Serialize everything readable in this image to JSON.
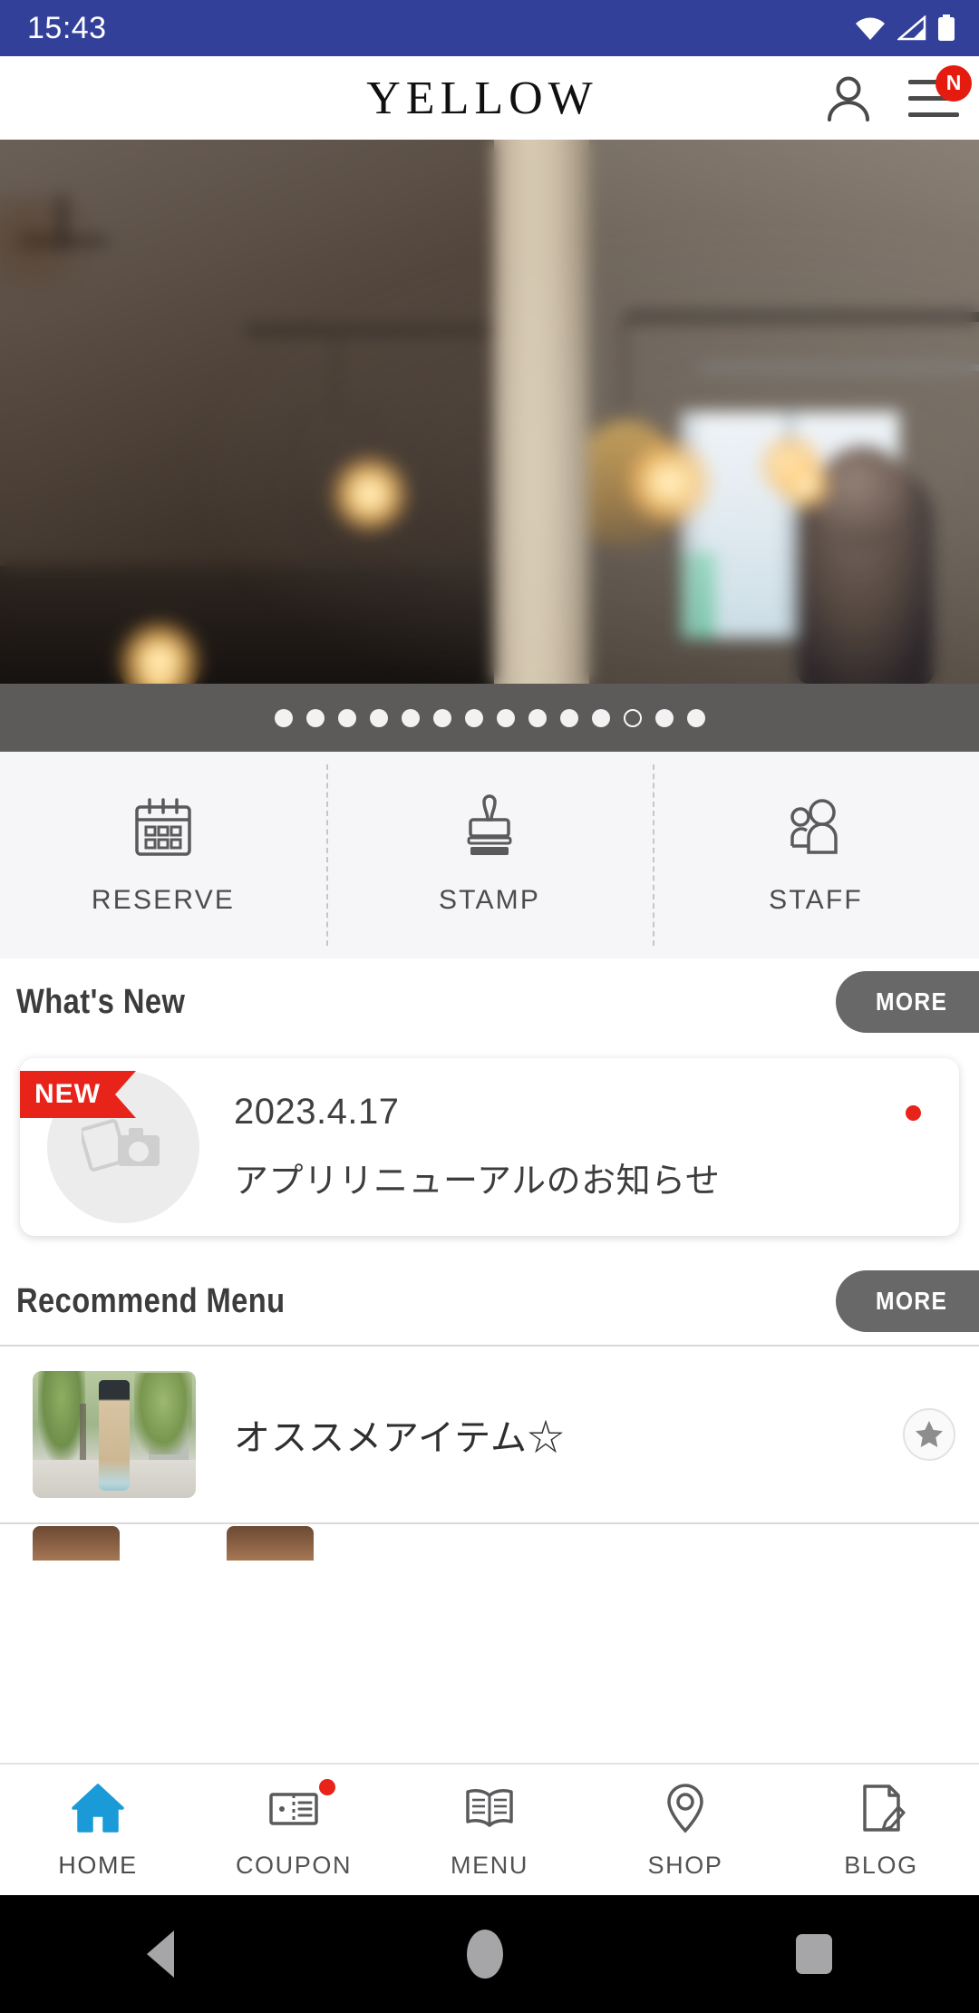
{
  "status_bar": {
    "time": "15:43",
    "icons": [
      "wifi-icon",
      "cellular-signal-icon",
      "battery-icon"
    ],
    "background_color": "#32409a"
  },
  "header": {
    "brand": "YELLOW",
    "account_icon": "person-icon",
    "menu_icon": "hamburger-menu-icon",
    "menu_badge": "N",
    "badge_color": "#e51b0f"
  },
  "hero": {
    "description": "blurred salon interior with pendant lights and window",
    "carousel": {
      "total_dots": 14,
      "active_index": 11
    }
  },
  "quick_actions": [
    {
      "label": "RESERVE",
      "icon": "calendar-icon"
    },
    {
      "label": "STAMP",
      "icon": "stamp-icon"
    },
    {
      "label": "STAFF",
      "icon": "people-icon"
    }
  ],
  "whats_new": {
    "title": "What's New",
    "more_label": "MORE",
    "items": [
      {
        "badge": "NEW",
        "date": "2023.4.17",
        "title": "アプリリニューアルのお知らせ",
        "thumbnail_icon": "photo-camera-placeholder-icon",
        "unread": true
      }
    ]
  },
  "recommend_menu": {
    "title": "Recommend Menu",
    "more_label": "MORE",
    "items": [
      {
        "title": "オススメアイテム☆",
        "favorite_icon": "star-icon"
      }
    ]
  },
  "bottom_nav": {
    "active": "HOME",
    "active_color": "#1a9ad6",
    "items": [
      {
        "label": "HOME",
        "icon": "home-icon",
        "active": true,
        "badge": false
      },
      {
        "label": "COUPON",
        "icon": "coupon-icon",
        "active": false,
        "badge": true
      },
      {
        "label": "MENU",
        "icon": "book-icon",
        "active": false,
        "badge": false
      },
      {
        "label": "SHOP",
        "icon": "location-pin-icon",
        "active": false,
        "badge": false
      },
      {
        "label": "BLOG",
        "icon": "document-pencil-icon",
        "active": false,
        "badge": false
      }
    ]
  },
  "android_nav": {
    "back": "back-triangle-icon",
    "home": "home-circle-icon",
    "recents": "recents-square-icon"
  }
}
